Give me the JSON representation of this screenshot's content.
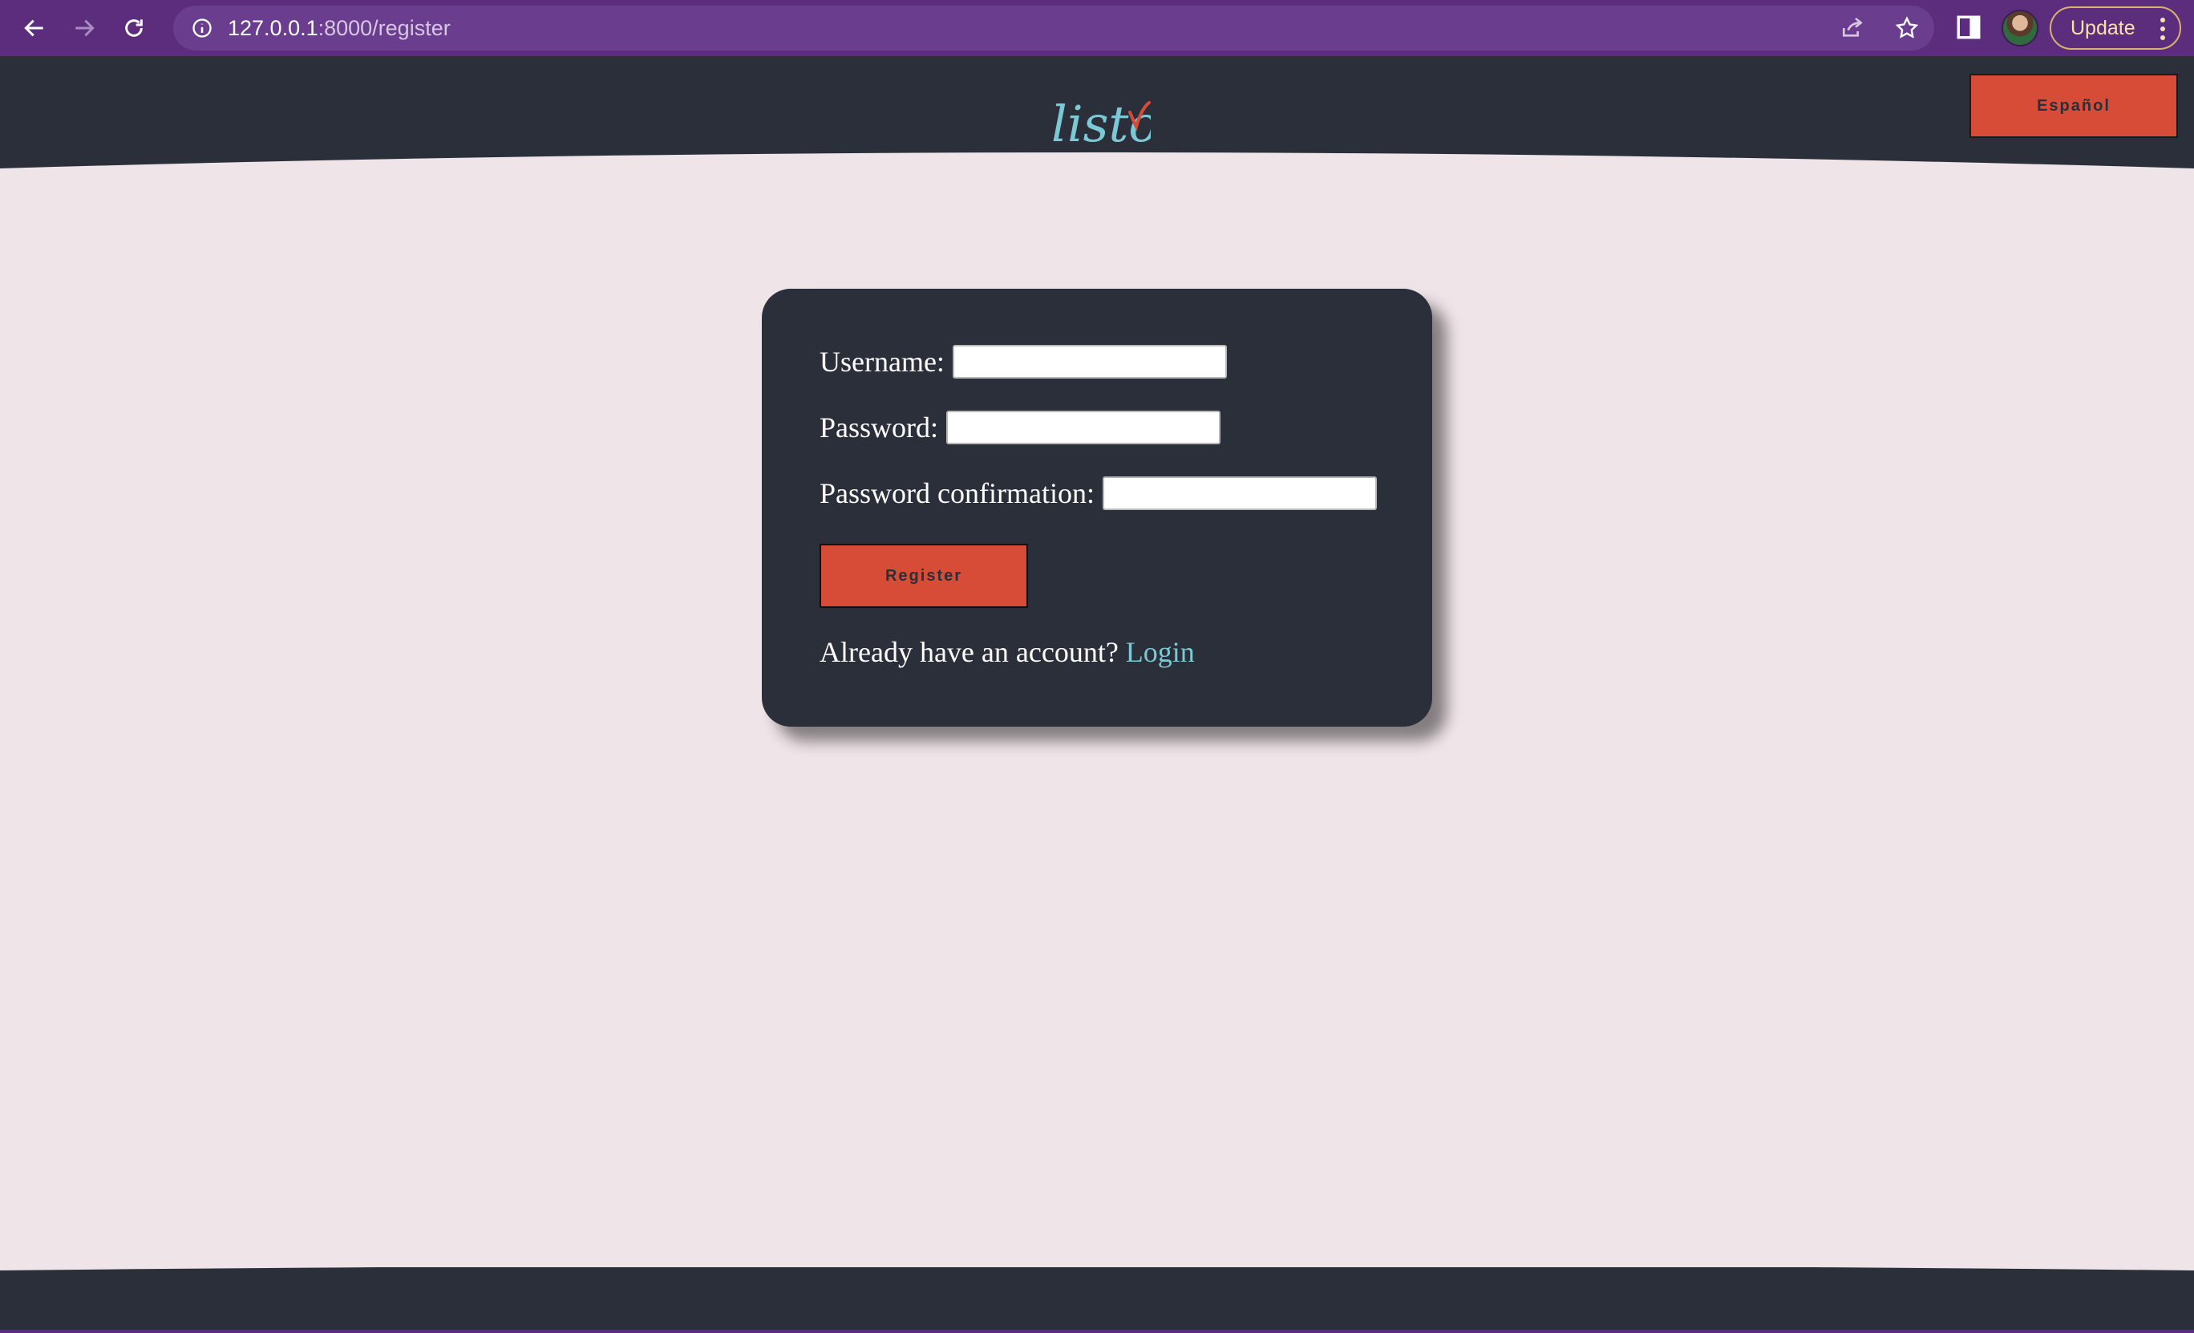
{
  "browser": {
    "url_host": "127.0.0.1",
    "url_rest": ":8000/register",
    "update_label": "Update"
  },
  "header": {
    "logo_text": "listo",
    "language_button": "Español"
  },
  "form": {
    "username_label": "Username:",
    "username_value": "",
    "password_label": "Password:",
    "password_value": "",
    "confirm_label": "Password confirmation:",
    "confirm_value": "",
    "register_button": "Register",
    "already_text": "Already have an account?",
    "login_link": "Login"
  },
  "colors": {
    "page_bg": "#efe4e8",
    "dark": "#2b2f3a",
    "accent": "#d64c36",
    "link": "#7cc9d6",
    "chrome": "#5b2d7c"
  }
}
